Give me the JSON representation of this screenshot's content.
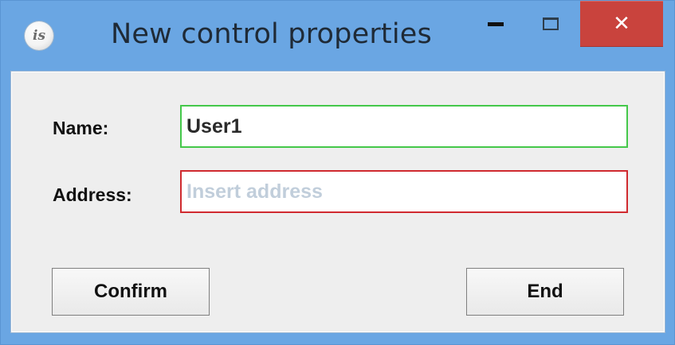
{
  "window": {
    "title": "New control properties",
    "icon": "is-app-icon",
    "icon_text": "is",
    "controls": {
      "minimize": "minimize-icon",
      "maximize": "maximize-icon",
      "close_label": "✕"
    },
    "colors": {
      "frame": "#6aa6e3",
      "close": "#c9433d",
      "client": "#eeeeee"
    }
  },
  "form": {
    "name_label": "Name:",
    "name_value": "User1",
    "name_border_color": "#44c84a",
    "address_label": "Address:",
    "address_value": "",
    "address_placeholder": "Insert address",
    "address_border_color": "#d02a2f"
  },
  "buttons": {
    "confirm_label": "Confirm",
    "end_label": "End"
  }
}
